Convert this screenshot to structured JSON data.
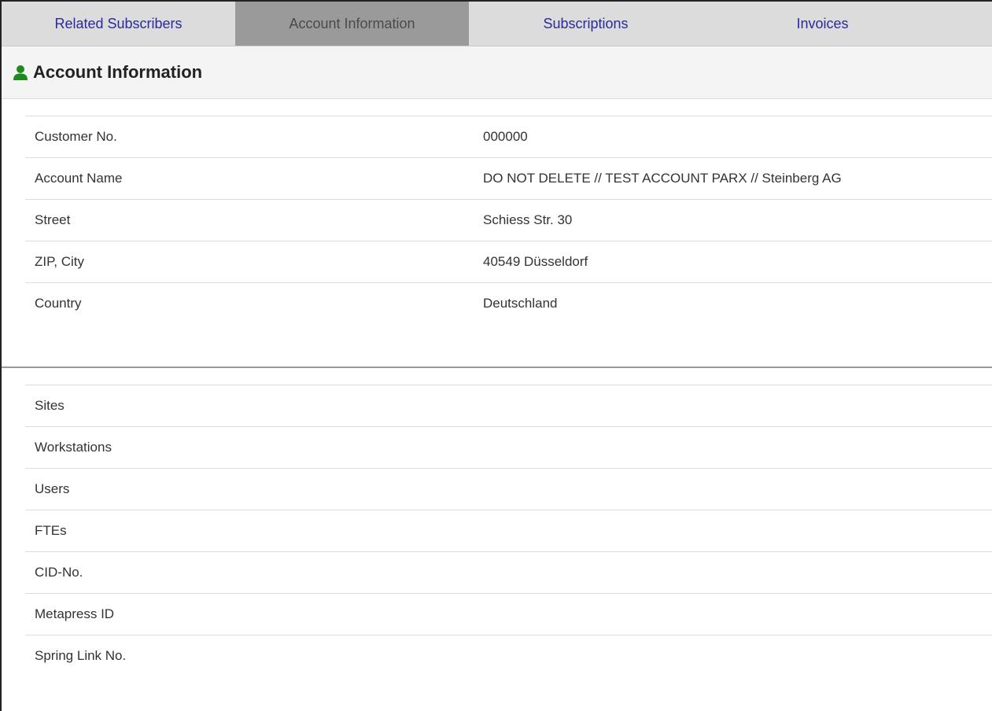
{
  "tabs": [
    {
      "label": "Related Subscribers",
      "active": false
    },
    {
      "label": "Account Information",
      "active": true
    },
    {
      "label": "Subscriptions",
      "active": false
    },
    {
      "label": "Invoices",
      "active": false
    }
  ],
  "section": {
    "icon": "user-icon",
    "icon_color": "#1e8a1e",
    "title": "Account Information"
  },
  "account_rows": [
    {
      "label": "Customer No.",
      "value": "000000"
    },
    {
      "label": "Account Name",
      "value": "DO NOT DELETE // TEST ACCOUNT PARX // Steinberg AG"
    },
    {
      "label": "Street",
      "value": "Schiess Str. 30"
    },
    {
      "label": "ZIP, City",
      "value": "40549 Düsseldorf"
    },
    {
      "label": "Country",
      "value": "Deutschland"
    }
  ],
  "extra_rows": [
    {
      "label": "Sites",
      "value": ""
    },
    {
      "label": "Workstations",
      "value": ""
    },
    {
      "label": "Users",
      "value": ""
    },
    {
      "label": "FTEs",
      "value": ""
    },
    {
      "label": "CID-No.",
      "value": ""
    },
    {
      "label": "Metapress ID",
      "value": ""
    },
    {
      "label": "Spring Link No.",
      "value": ""
    }
  ]
}
